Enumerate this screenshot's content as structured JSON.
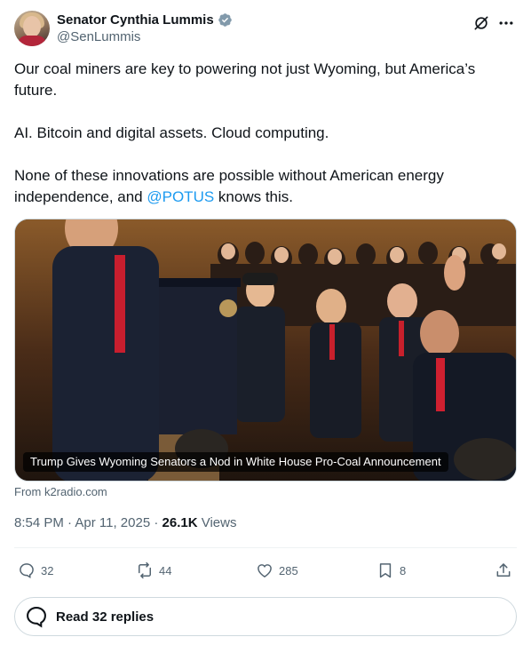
{
  "author": {
    "name": "Senator Cynthia Lummis",
    "handle": "@SenLummis",
    "verified": true,
    "verified_color": "#829aab"
  },
  "tweet": {
    "line1": "Our coal miners are key to powering not just Wyoming, but America’s future.",
    "line2": "AI. Bitcoin and digital assets. Cloud computing.",
    "line3_before": "None of these innovations are possible without American energy independence, and ",
    "mention": "@POTUS",
    "line3_after": " knows this."
  },
  "card": {
    "caption": "Trump Gives Wyoming Senators a Nod in White House Pro-Coal Announcement",
    "source": "From k2radio.com"
  },
  "meta": {
    "time": "8:54 PM",
    "sep1": " · ",
    "date": "Apr 11, 2025",
    "sep2": " · ",
    "views_count": "26.1K",
    "views_label": " Views"
  },
  "actions": {
    "replies": "32",
    "reposts": "44",
    "likes": "285",
    "bookmarks": "8"
  },
  "read_replies": "Read 32 replies",
  "colors": {
    "link": "#1d9bf0",
    "secondary_text": "#536471",
    "border": "#cfd9de"
  }
}
